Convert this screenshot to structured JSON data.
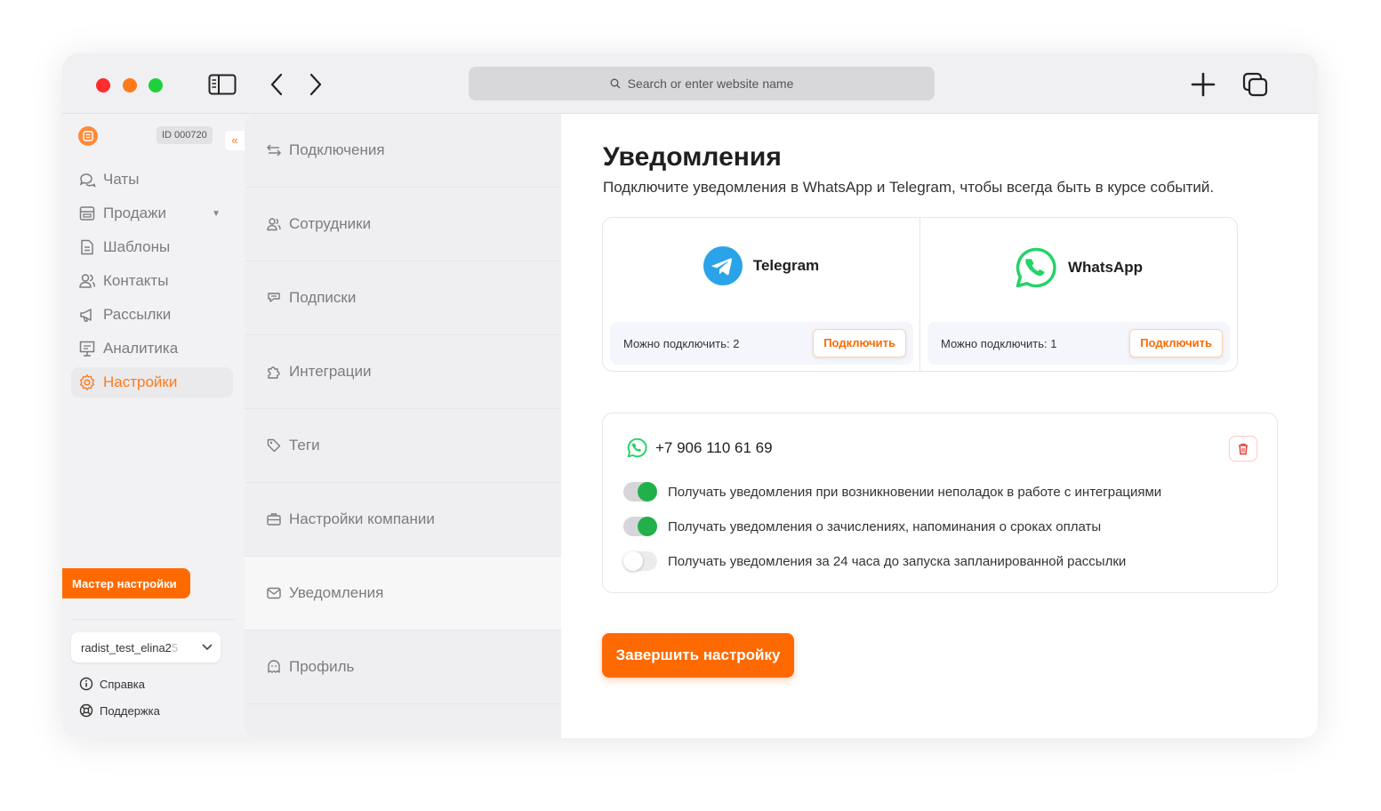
{
  "browser": {
    "address_placeholder": "Search or enter website name"
  },
  "sidebar": {
    "account_id": "ID 000720",
    "items": [
      {
        "label": "Чаты",
        "icon": "chat-icon"
      },
      {
        "label": "Продажи",
        "icon": "sales-icon"
      },
      {
        "label": "Шаблоны",
        "icon": "template-icon"
      },
      {
        "label": "Контакты",
        "icon": "contacts-icon"
      },
      {
        "label": "Рассылки",
        "icon": "megaphone-icon"
      },
      {
        "label": "Аналитика",
        "icon": "analytics-icon"
      },
      {
        "label": "Настройки",
        "icon": "gear-icon"
      }
    ],
    "active_index": 6,
    "master_button": "Мастер настройки",
    "account_name": "radist_test_elina2",
    "account_name_faded": "5",
    "help": "Справка",
    "support": "Поддержка"
  },
  "settings_menu": {
    "items": [
      {
        "label": "Подключения",
        "icon": "arrows-icon"
      },
      {
        "label": "Сотрудники",
        "icon": "users-icon"
      },
      {
        "label": "Подписки",
        "icon": "subscription-icon"
      },
      {
        "label": "Интеграции",
        "icon": "puzzle-icon"
      },
      {
        "label": "Теги",
        "icon": "tag-icon"
      },
      {
        "label": "Настройки компании",
        "icon": "briefcase-icon"
      },
      {
        "label": "Уведомления",
        "icon": "mail-icon"
      },
      {
        "label": "Профиль",
        "icon": "profile-icon"
      }
    ],
    "active_index": 6
  },
  "main": {
    "title": "Уведомления",
    "subtitle": "Подключите уведомления в WhatsApp и Telegram, чтобы всегда быть в курсе событий.",
    "channels": {
      "telegram": {
        "name": "Telegram",
        "available": "Можно подключить: 2",
        "button": "Подключить"
      },
      "whatsapp": {
        "name": "WhatsApp",
        "available": "Можно подключить: 1",
        "button": "Подключить"
      }
    },
    "phone": "+7 906 110 61 69",
    "toggles": [
      {
        "label": "Получать уведомления при возникновении неполадок в работе с интеграциями",
        "on": true
      },
      {
        "label": "Получать уведомления о зачислениях, напоминания о сроках оплаты",
        "on": true
      },
      {
        "label": "Получать уведомления за 24 часа до запуска запланированной рассылки",
        "on": false
      }
    ],
    "finish_button": "Завершить настройку"
  },
  "colors": {
    "accent": "#ff6a00",
    "toggle_on": "#22b04a",
    "telegram": "#2aa3e8",
    "whatsapp": "#25d366"
  }
}
